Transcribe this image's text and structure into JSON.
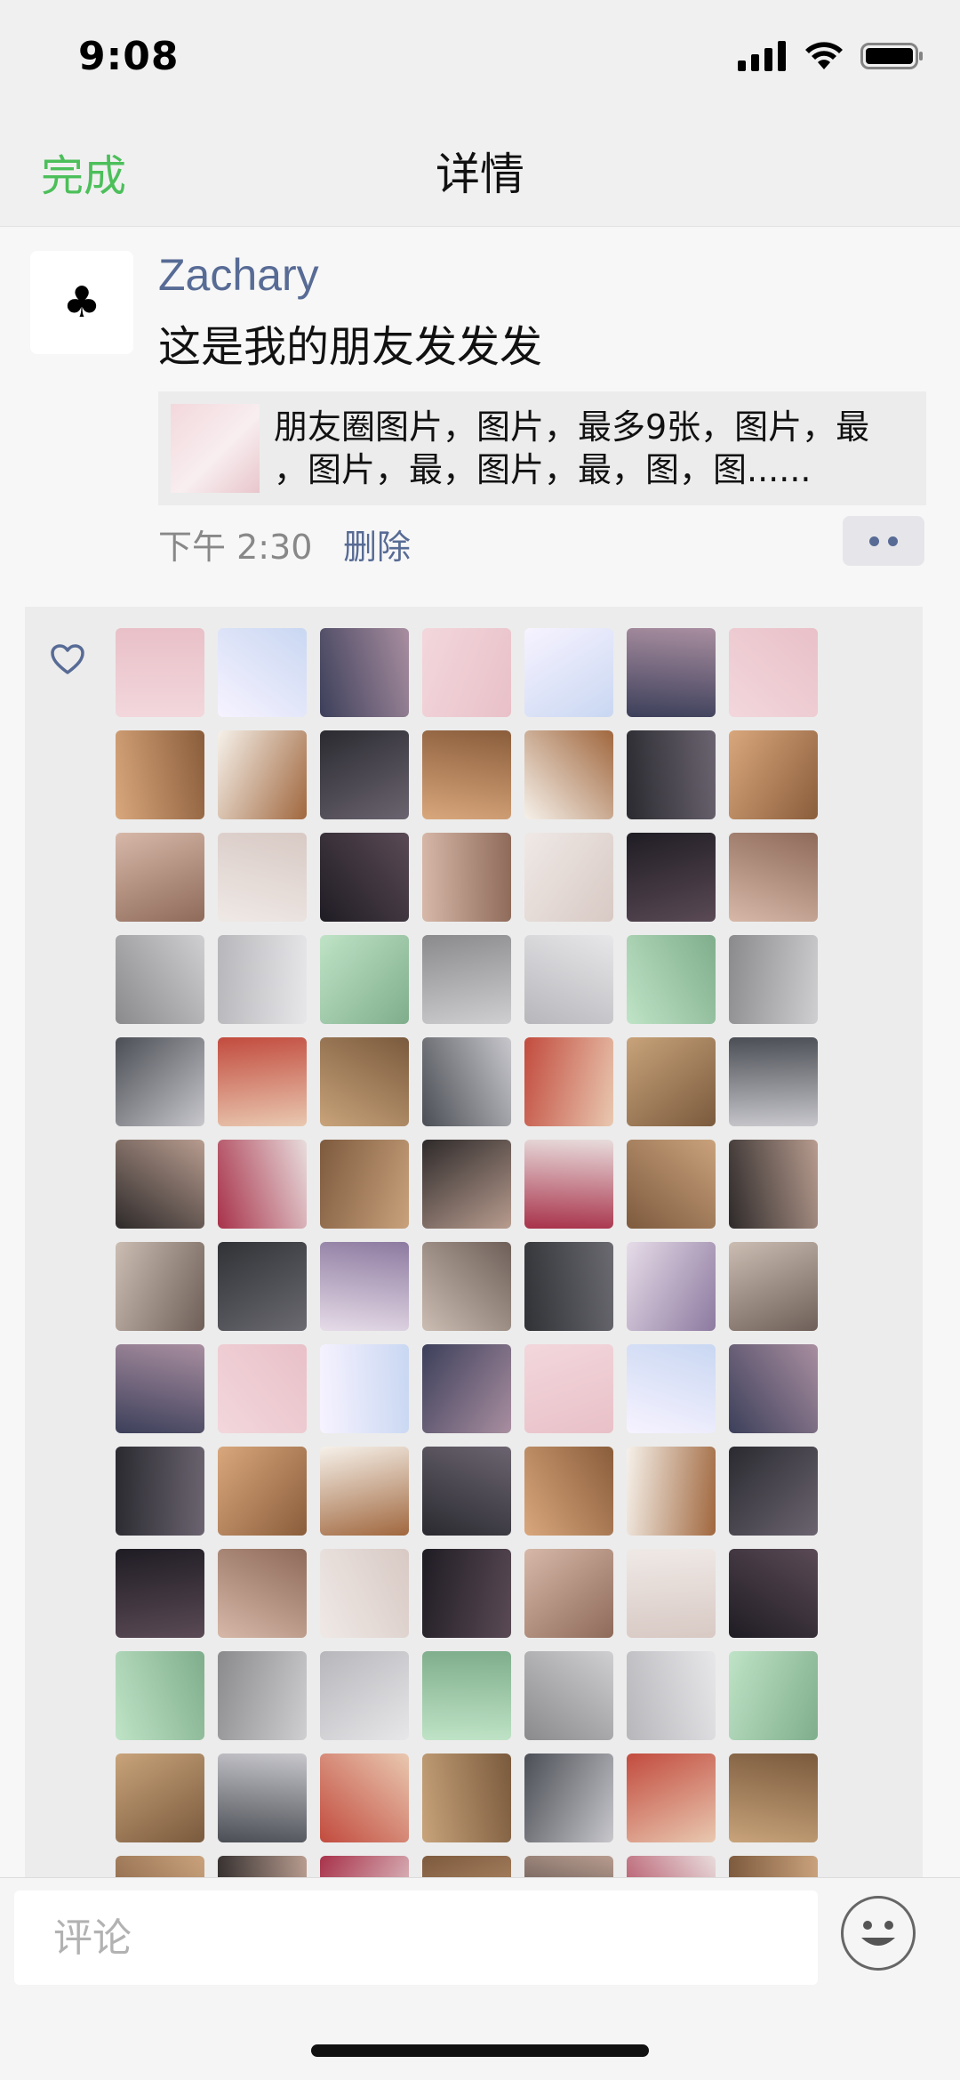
{
  "status_bar": {
    "time": "9:08",
    "icons": [
      "signal-icon",
      "wifi-icon",
      "battery-icon"
    ]
  },
  "nav": {
    "done_label": "完成",
    "title": "详情"
  },
  "post": {
    "avatar_symbol": "♣",
    "username": "Zachary",
    "text": "这是我的朋友发发发",
    "link": {
      "line1": "朋友圈图片，图片，最多9张，图片，最",
      "line2": "，图片，最，图片，最，图，图......"
    },
    "time": "下午 2:30",
    "delete_label": "删除"
  },
  "likes": {
    "icon": "heart-icon",
    "avatar_count": 91
  },
  "comment": {
    "placeholder": "评论",
    "emoji_icon": "emoji-icon"
  },
  "colors": {
    "accent_green": "#4cbf5a",
    "link_blue": "#576b95"
  }
}
